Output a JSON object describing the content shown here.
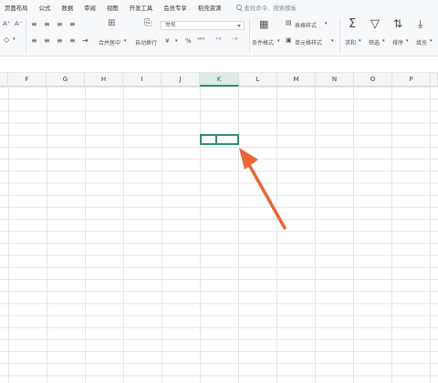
{
  "menubar": {
    "items": [
      "页面布局",
      "公式",
      "数据",
      "审阅",
      "视图",
      "开发工具",
      "会员专享",
      "稻壳资源"
    ],
    "search_placeholder": "查找命令、搜索模板"
  },
  "ribbon": {
    "merge_label": "合并居中",
    "wrap_label": "自动换行",
    "number_format": "常规",
    "conditional_format_label": "条件格式",
    "table_style_label": "表格样式",
    "cell_style_label": "单元格样式",
    "sum_label": "求和",
    "filter_label": "筛选",
    "sort_label": "排序",
    "fill_label": "填充",
    "font_size_up": "A⁺",
    "font_size_down": "A⁻",
    "currency_symbol": "¥",
    "percent_symbol": "%"
  },
  "columns": [
    "F",
    "G",
    "H",
    "I",
    "J",
    "K",
    "L",
    "M",
    "N",
    "O",
    "P"
  ],
  "active_column": "K",
  "colors": {
    "selection": "#2f8f6f",
    "arrow": "#e8663a",
    "header_bg": "#f4f5f7"
  }
}
